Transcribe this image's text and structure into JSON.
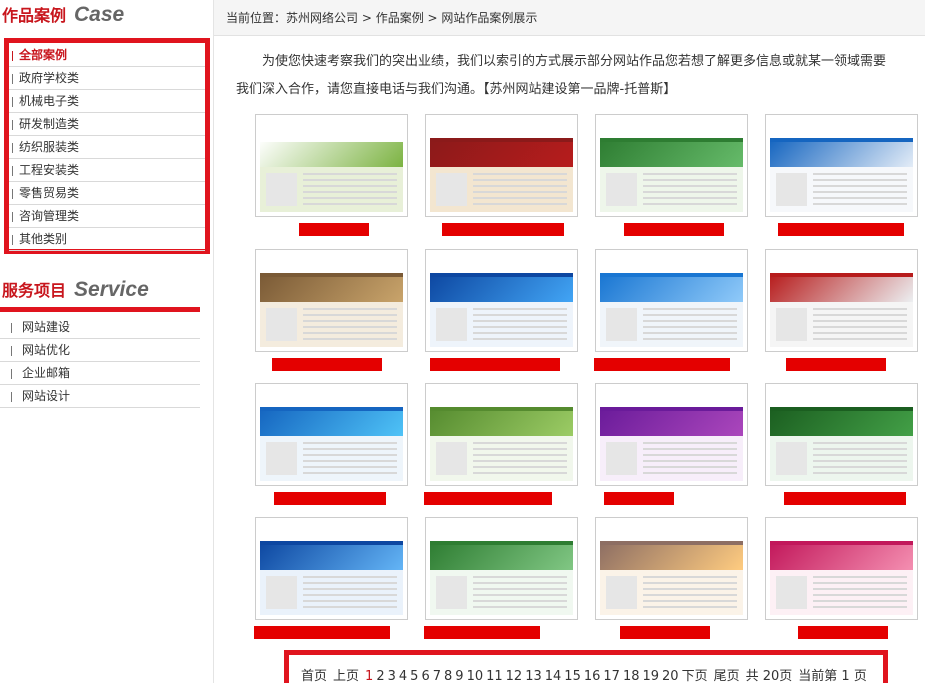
{
  "sidebar": {
    "case_title_cn": "作品案例",
    "case_title_en": "Case",
    "case_items": [
      {
        "label": "全部案例",
        "active": true
      },
      {
        "label": "政府学校类"
      },
      {
        "label": "机械电子类"
      },
      {
        "label": "研发制造类"
      },
      {
        "label": "纺织服装类"
      },
      {
        "label": "工程安装类"
      },
      {
        "label": "零售贸易类"
      },
      {
        "label": "咨询管理类"
      },
      {
        "label": "其他类别"
      }
    ],
    "service_title_cn": "服务项目",
    "service_title_en": "Service",
    "service_items": [
      {
        "label": "网站建设"
      },
      {
        "label": "网站优化"
      },
      {
        "label": "企业邮箱"
      },
      {
        "label": "网站设计"
      }
    ]
  },
  "breadcrumb": {
    "prefix": "当前位置：",
    "items": [
      "苏州网络公司",
      "作品案例",
      "网站作品案例展示"
    ],
    "separator": " > "
  },
  "intro": {
    "line1": "为使您快速考察我们的突出业绩，我们以索引的方式展示部分网站作品您若想了解更多信息或就某一领域需要",
    "line2": "我们深入合作，请您直接电话与我们沟通。【苏州网站建设第一品牌-托普斯】"
  },
  "cases": [
    {
      "icon": "site-screenshot-icon",
      "colors": [
        "#ffffff",
        "#7cb342",
        "#e8f0d8"
      ]
    },
    {
      "icon": "site-screenshot-icon",
      "colors": [
        "#8b1a1a",
        "#b71c1c",
        "#f3e6d0"
      ]
    },
    {
      "icon": "site-screenshot-icon",
      "colors": [
        "#2e7d32",
        "#66bb6a",
        "#eef6ea"
      ]
    },
    {
      "icon": "site-screenshot-icon",
      "colors": [
        "#1565c0",
        "#e3ecf7",
        "#f6f8fb"
      ]
    },
    {
      "icon": "site-screenshot-icon",
      "colors": [
        "#7a5a36",
        "#c9a46b",
        "#f4ecde"
      ]
    },
    {
      "icon": "site-screenshot-icon",
      "colors": [
        "#0d47a1",
        "#42a5f5",
        "#eef4fb"
      ]
    },
    {
      "icon": "site-screenshot-icon",
      "colors": [
        "#1976d2",
        "#90caf9",
        "#f0f5fa"
      ]
    },
    {
      "icon": "site-screenshot-icon",
      "colors": [
        "#b71c1c",
        "#eceff1",
        "#f5f5f5"
      ]
    },
    {
      "icon": "site-screenshot-icon",
      "colors": [
        "#1565c0",
        "#4fc3f7",
        "#eef5fb"
      ]
    },
    {
      "icon": "site-screenshot-icon",
      "colors": [
        "#558b2f",
        "#9ccc65",
        "#f1f7ec"
      ]
    },
    {
      "icon": "site-screenshot-icon",
      "colors": [
        "#6a1b9a",
        "#ab47bc",
        "#f7eefa"
      ]
    },
    {
      "icon": "site-screenshot-icon",
      "colors": [
        "#1b5e20",
        "#43a047",
        "#edf6ee"
      ]
    },
    {
      "icon": "site-screenshot-icon",
      "colors": [
        "#0d47a1",
        "#64b5f6",
        "#eaf2fb"
      ]
    },
    {
      "icon": "site-screenshot-icon",
      "colors": [
        "#2e7d32",
        "#81c784",
        "#f0f8f0"
      ]
    },
    {
      "icon": "site-screenshot-icon",
      "colors": [
        "#8d6e63",
        "#ffcc80",
        "#fbf3e8"
      ]
    },
    {
      "icon": "site-screenshot-icon",
      "colors": [
        "#c2185b",
        "#f48fb1",
        "#fdf0f5"
      ]
    }
  ],
  "pager": {
    "first": "首页",
    "prev": "上页",
    "pages": [
      "1",
      "2",
      "3",
      "4",
      "5",
      "6",
      "7",
      "8",
      "9",
      "10",
      "11",
      "12",
      "13",
      "14",
      "15",
      "16",
      "17",
      "18",
      "19",
      "20"
    ],
    "current": "1",
    "next": "下页",
    "last": "尾页",
    "total": "共 20页",
    "current_info": "当前第 1 页"
  },
  "colors": {
    "accent": "#e0141e",
    "link": "#c8161d"
  }
}
